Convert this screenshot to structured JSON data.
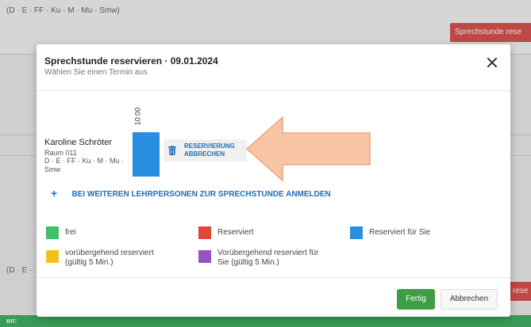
{
  "background": {
    "subjects_top": "(D · E · FF · Ku · M · Mu · Smw)",
    "request_button": "Sprechstunde rese",
    "subjects_mid": "(D · E ·",
    "request_button_2": "rese",
    "green_bar": "en:"
  },
  "modal": {
    "title": "Sprechstunde reservieren · 09.01.2024",
    "subtitle": "Wählen Sie einen Termin aus",
    "close_icon": "close-icon",
    "time": "10:00",
    "teacher": {
      "name": "Karoline Schröter",
      "room": "Raum 011",
      "subjects": "D · E · FF · Ku · M · Mu · Smw"
    },
    "cancel_reservation": "RESERVIERUNG ABBRECHEN",
    "add_teachers": "BEI WEITEREN LEHRPERSONEN ZUR SPRECHSTUNDE ANMELDEN",
    "legend": [
      {
        "label": "frei",
        "color": "#3cc26a"
      },
      {
        "label": "Reserviert",
        "color": "#e2463a"
      },
      {
        "label": "Reserviert für Sie",
        "color": "#2a8ee0"
      },
      {
        "label": "vorübergehend reserviert (gültig 5 Min.)",
        "color": "#f2c21b"
      },
      {
        "label": "Vorübergehend reserviert für Sie (gültig 5 Min.)",
        "color": "#9652c7"
      }
    ],
    "buttons": {
      "done": "Fertig",
      "cancel": "Abbrechen"
    }
  },
  "colors": {
    "slot_reserved_for_you": "#2a8ee0",
    "link_blue": "#1d6fb8",
    "annotation_arrow": "#f8c6a6"
  }
}
